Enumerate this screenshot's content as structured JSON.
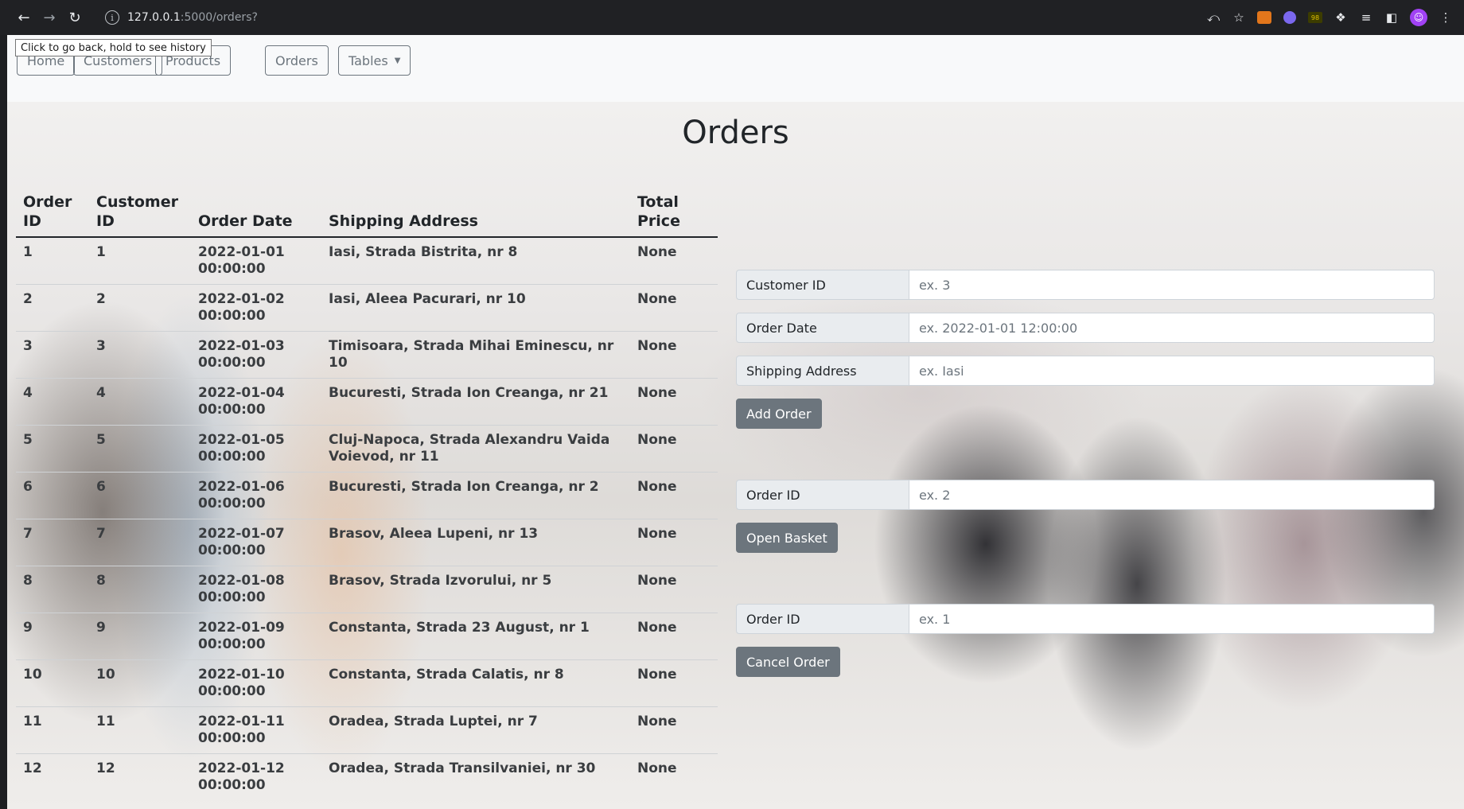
{
  "browser": {
    "url_host": "127.0.0.1",
    "url_path": ":5000/orders?",
    "tooltip": "Click to go back, hold to see history",
    "profile_initial": "☺",
    "ext_badge": "98"
  },
  "nav": {
    "home": "Home",
    "customers": "Customers",
    "products": "Products",
    "orders": "Orders",
    "tables": "Tables"
  },
  "page": {
    "title": "Orders"
  },
  "table": {
    "headers": {
      "order_id": "Order ID",
      "customer_id": "Customer ID",
      "order_date": "Order Date",
      "shipping_address": "Shipping Address",
      "total_price": "Total Price"
    },
    "rows": [
      {
        "order_id": "1",
        "customer_id": "1",
        "order_date": "2022-01-01 00:00:00",
        "shipping_address": "Iasi, Strada Bistrita, nr 8",
        "total_price": "None"
      },
      {
        "order_id": "2",
        "customer_id": "2",
        "order_date": "2022-01-02 00:00:00",
        "shipping_address": "Iasi, Aleea Pacurari, nr 10",
        "total_price": "None"
      },
      {
        "order_id": "3",
        "customer_id": "3",
        "order_date": "2022-01-03 00:00:00",
        "shipping_address": "Timisoara, Strada Mihai Eminescu, nr 10",
        "total_price": "None"
      },
      {
        "order_id": "4",
        "customer_id": "4",
        "order_date": "2022-01-04 00:00:00",
        "shipping_address": "Bucuresti, Strada Ion Creanga, nr 21",
        "total_price": "None"
      },
      {
        "order_id": "5",
        "customer_id": "5",
        "order_date": "2022-01-05 00:00:00",
        "shipping_address": "Cluj-Napoca, Strada Alexandru Vaida Voievod, nr 11",
        "total_price": "None"
      },
      {
        "order_id": "6",
        "customer_id": "6",
        "order_date": "2022-01-06 00:00:00",
        "shipping_address": "Bucuresti, Strada Ion Creanga, nr 2",
        "total_price": "None"
      },
      {
        "order_id": "7",
        "customer_id": "7",
        "order_date": "2022-01-07 00:00:00",
        "shipping_address": "Brasov, Aleea Lupeni, nr 13",
        "total_price": "None"
      },
      {
        "order_id": "8",
        "customer_id": "8",
        "order_date": "2022-01-08 00:00:00",
        "shipping_address": "Brasov, Strada Izvorului, nr 5",
        "total_price": "None"
      },
      {
        "order_id": "9",
        "customer_id": "9",
        "order_date": "2022-01-09 00:00:00",
        "shipping_address": "Constanta, Strada 23 August, nr 1",
        "total_price": "None"
      },
      {
        "order_id": "10",
        "customer_id": "10",
        "order_date": "2022-01-10 00:00:00",
        "shipping_address": "Constanta, Strada Calatis, nr 8",
        "total_price": "None"
      },
      {
        "order_id": "11",
        "customer_id": "11",
        "order_date": "2022-01-11 00:00:00",
        "shipping_address": "Oradea, Strada Luptei, nr 7",
        "total_price": "None"
      },
      {
        "order_id": "12",
        "customer_id": "12",
        "order_date": "2022-01-12 00:00:00",
        "shipping_address": "Oradea, Strada Transilvaniei, nr 30",
        "total_price": "None"
      }
    ]
  },
  "add_form": {
    "customer_id_label": "Customer ID",
    "customer_id_placeholder": "ex. 3",
    "order_date_label": "Order Date",
    "order_date_placeholder": "ex. 2022-01-01 12:00:00",
    "shipping_address_label": "Shipping Address",
    "shipping_address_placeholder": "ex. Iasi",
    "submit": "Add Order"
  },
  "basket_form": {
    "order_id_label": "Order ID",
    "order_id_placeholder": "ex. 2",
    "submit": "Open Basket"
  },
  "cancel_form": {
    "order_id_label": "Order ID",
    "order_id_placeholder": "ex. 1",
    "submit": "Cancel Order"
  }
}
